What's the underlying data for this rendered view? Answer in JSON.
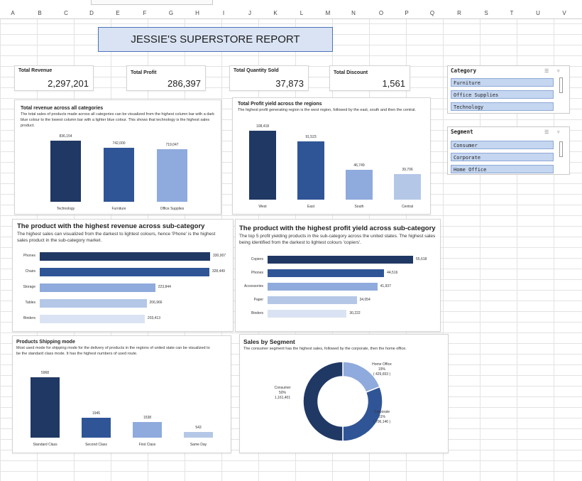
{
  "columns": [
    "A",
    "B",
    "C",
    "D",
    "E",
    "F",
    "G",
    "H",
    "I",
    "J",
    "K",
    "L",
    "M",
    "N",
    "O",
    "P",
    "Q",
    "R",
    "S",
    "T",
    "U",
    "V"
  ],
  "report_title": "JESSIE'S SUPERSTORE REPORT",
  "kpis": [
    {
      "label": "Total Revenue",
      "value": "2,297,201"
    },
    {
      "label": "Total Profit",
      "value": "286,397"
    },
    {
      "label": "Total Quantity Sold",
      "value": "37,873"
    },
    {
      "label": "Total Discount",
      "value": "1,561"
    }
  ],
  "slicers": {
    "category": {
      "title": "Category",
      "items": [
        "Furniture",
        "Office Supplies",
        "Technology"
      ],
      "icons": [
        "multi-select-icon",
        "clear-filter-icon"
      ]
    },
    "segment": {
      "title": "Segment",
      "items": [
        "Consumer",
        "Corporate",
        "Home Office"
      ],
      "icons": [
        "multi-select-icon",
        "clear-filter-icon"
      ]
    }
  },
  "charts": {
    "revenue_category": {
      "title": "Total revenue across all categories",
      "desc": "The total sales of products made across all categories can be visualized from the highest column bar with a dark blue colour to the lowest column bar with a lighter blue colour. This shows that technology is the highest sales product.",
      "chart_data": {
        "type": "bar",
        "categories": [
          "Technology",
          "Furniture",
          "Office Supplies"
        ],
        "values": [
          836154,
          742000,
          719047
        ],
        "labels": [
          "836,154",
          "742,000",
          "719,047"
        ],
        "colors": [
          "#203864",
          "#2f5597",
          "#8faadc"
        ]
      }
    },
    "profit_region": {
      "title": "Total Profit yield across the regions",
      "desc": "The highest profit generating region is the west region, followed by the east, south and then the central.",
      "chart_data": {
        "type": "bar",
        "categories": [
          "West",
          "East",
          "South",
          "Central"
        ],
        "values": [
          108418,
          91523,
          46749,
          39706
        ],
        "labels": [
          "108,418",
          "91,523",
          "46,749",
          "39,706"
        ],
        "colors": [
          "#203864",
          "#2f5597",
          "#8faadc",
          "#b4c7e7"
        ]
      }
    },
    "revenue_subcat": {
      "title": "The product with the highest revenue across sub-category",
      "desc": "The highest sales can visualized from the darkest to lightest colours, hence 'Phone' is the highest sales product in the sub-category market.",
      "chart_data": {
        "type": "bar",
        "orientation": "horizontal",
        "categories": [
          "Phones",
          "Chairs",
          "Storage",
          "Tables",
          "Binders"
        ],
        "values": [
          330007,
          328449,
          223844,
          206966,
          203413
        ],
        "labels": [
          "330,007",
          "328,449",
          "223,844",
          "206,966",
          "203,413"
        ],
        "colors": [
          "#203864",
          "#2f5597",
          "#8faadc",
          "#b4c7e7",
          "#dae3f3"
        ]
      }
    },
    "profit_subcat": {
      "title": "The product with the highest profit yield across sub-category",
      "desc": "The top 5 profit yielding products in the sub-category across the united states. The highest sales being identified from the darkest to lightest colours 'copiers'.",
      "chart_data": {
        "type": "bar",
        "orientation": "horizontal",
        "categories": [
          "Copiers",
          "Phones",
          "Accessories",
          "Paper",
          "Binders"
        ],
        "values": [
          55618,
          44516,
          41937,
          34054,
          30222
        ],
        "labels": [
          "55,618",
          "44,516",
          "41,937",
          "34,054",
          "30,222"
        ],
        "colors": [
          "#203864",
          "#2f5597",
          "#8faadc",
          "#b4c7e7",
          "#dae3f3"
        ]
      }
    },
    "shipping": {
      "title": "Products Shipping mode",
      "desc": "Most used mode for shipping mode for the delivery of products in the regions of united state can be visualized to be the standard class mode. It has the highest numbers of used route.",
      "chart_data": {
        "type": "bar",
        "categories": [
          "Standard Class",
          "Second Class",
          "First Class",
          "Same Day"
        ],
        "values": [
          5968,
          1945,
          1538,
          543
        ],
        "labels": [
          "5968",
          "1945",
          "1538",
          "543"
        ],
        "colors": [
          "#203864",
          "#2f5597",
          "#8faadc",
          "#b4c7e7"
        ]
      }
    },
    "segment": {
      "title": "Sales by Segment",
      "desc": "The consumer segment has the highest sales, followed by the corporate, then the home office.",
      "chart_data": {
        "type": "pie",
        "donut": true,
        "slices": [
          {
            "name": "Consumer",
            "percent": "50%",
            "value": "1,161,401",
            "share": 0.5,
            "color": "#203864"
          },
          {
            "name": "Corporate",
            "percent": "31%",
            "value": "( 706,146 )",
            "share": 0.31,
            "color": "#2f5597"
          },
          {
            "name": "Home Office",
            "percent": "19%",
            "value": "( 429,653 )",
            "share": 0.19,
            "color": "#8faadc"
          }
        ]
      }
    }
  }
}
